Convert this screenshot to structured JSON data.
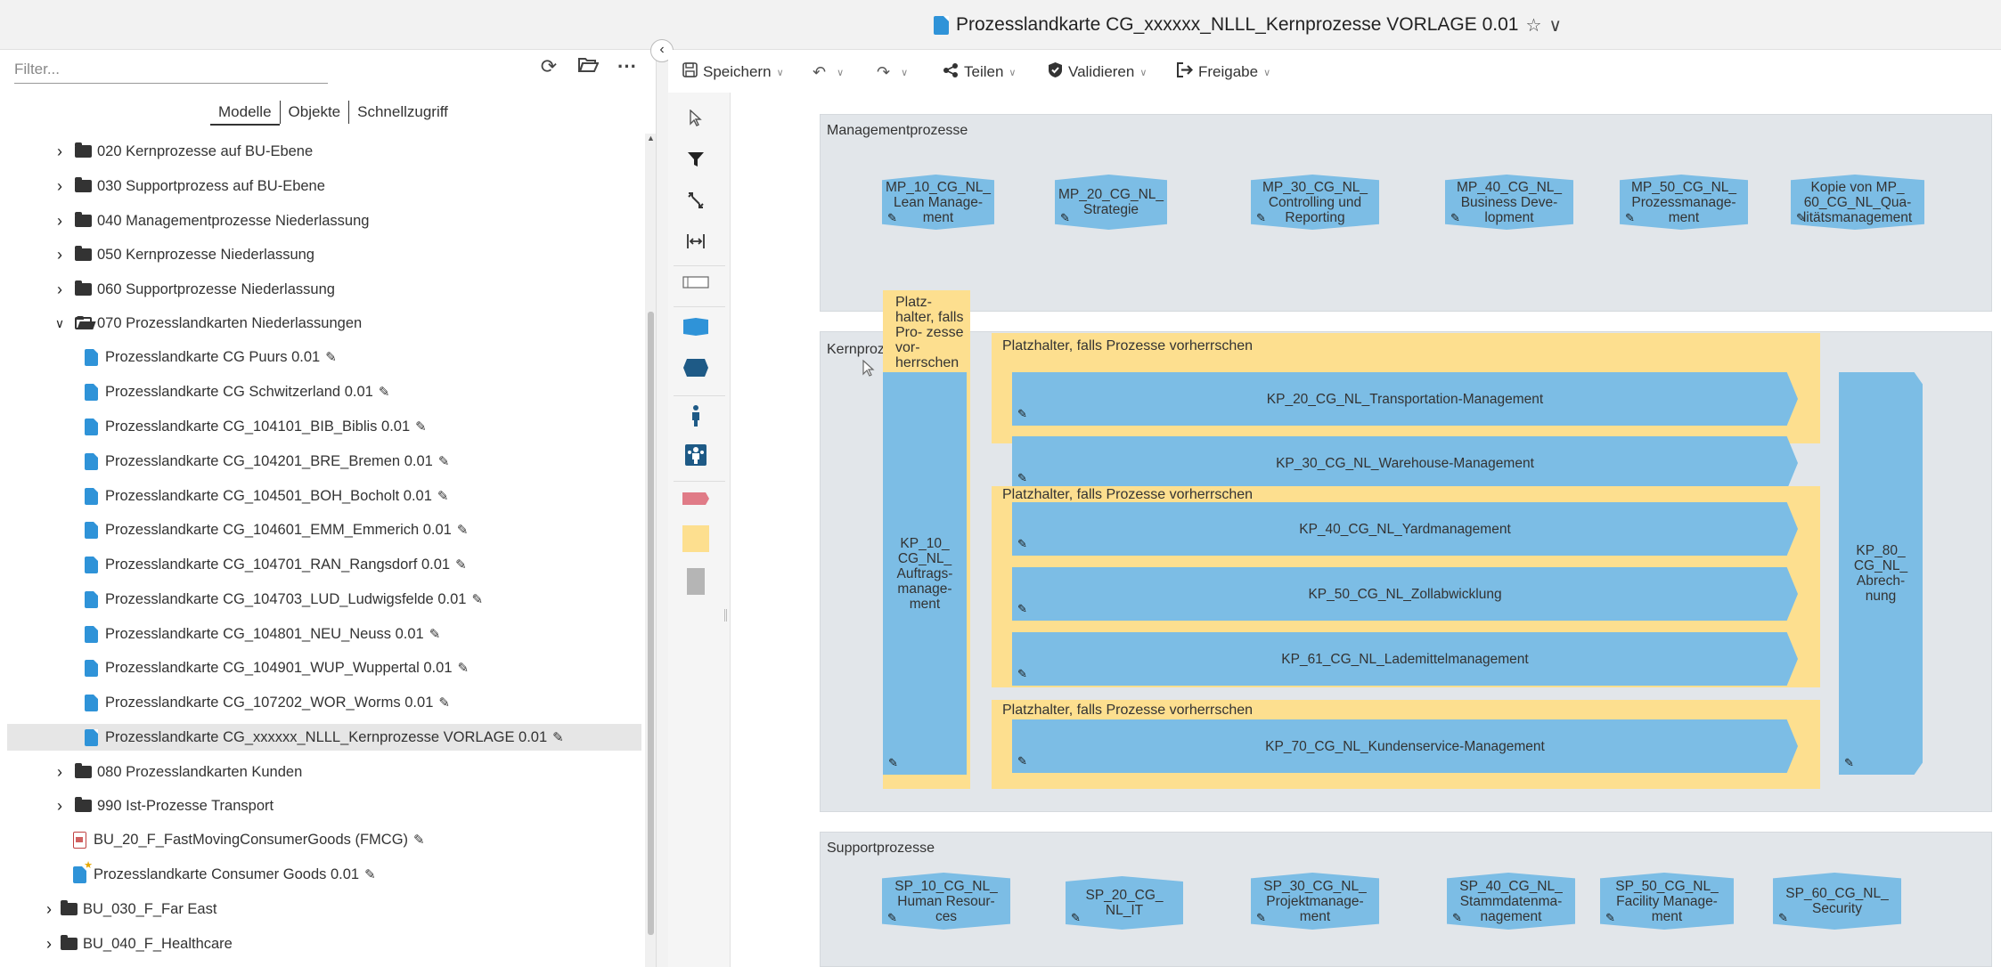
{
  "title": "Prozesslandkarte CG_xxxxxx_NLLL_Kernprozesse VORLAGE 0.01",
  "left_panel": {
    "filter_placeholder": "Filter...",
    "tabs": [
      "Modelle",
      "Objekte",
      "Schnellzugriff"
    ],
    "tree": [
      {
        "label": "020 Kernprozesse auf BU-Ebene"
      },
      {
        "label": "030 Supportprozess auf BU-Ebene"
      },
      {
        "label": "040 Managementprozesse Niederlassung"
      },
      {
        "label": "050 Kernprozesse Niederlassung"
      },
      {
        "label": "060 Supportprozesse Niederlassung"
      },
      {
        "label": "070 Prozesslandkarten Niederlassungen"
      },
      {
        "label": "Prozesslandkarte CG Puurs 0.01"
      },
      {
        "label": "Prozesslandkarte CG Schwitzerland 0.01"
      },
      {
        "label": "Prozesslandkarte CG_104101_BIB_Biblis 0.01"
      },
      {
        "label": "Prozesslandkarte CG_104201_BRE_Bremen 0.01"
      },
      {
        "label": "Prozesslandkarte CG_104501_BOH_Bocholt 0.01"
      },
      {
        "label": "Prozesslandkarte CG_104601_EMM_Emmerich 0.01"
      },
      {
        "label": "Prozesslandkarte CG_104701_RAN_Rangsdorf 0.01"
      },
      {
        "label": "Prozesslandkarte CG_104703_LUD_Ludwigsfelde 0.01"
      },
      {
        "label": "Prozesslandkarte CG_104801_NEU_Neuss 0.01"
      },
      {
        "label": "Prozesslandkarte CG_104901_WUP_Wuppertal 0.01"
      },
      {
        "label": "Prozesslandkarte CG_107202_WOR_Worms 0.01"
      },
      {
        "label": "Prozesslandkarte CG_xxxxxx_NLLL_Kernprozesse VORLAGE 0.01"
      },
      {
        "label": "080 Prozesslandkarten Kunden"
      },
      {
        "label": "990 Ist-Prozesse Transport"
      },
      {
        "label": "BU_20_F_FastMovingConsumerGoods (FMCG)"
      },
      {
        "label": "Prozesslandkarte Consumer Goods 0.01"
      },
      {
        "label": "BU_030_F_Far East"
      },
      {
        "label": "BU_040_F_Healthcare"
      }
    ]
  },
  "toolbar": {
    "save": "Speichern",
    "share": "Teilen",
    "validate": "Validieren",
    "release": "Freigabe"
  },
  "canvas": {
    "lanes": {
      "management": "Managementprozesse",
      "kern": "Kernprozesse",
      "support": "Supportprozesse"
    },
    "management_processes": [
      "MP_10_CG_NL_ Lean Manage- ment",
      "MP_20_CG_NL_ Strategie",
      "MP_30_CG_NL_ Controlling und Reporting",
      "MP_40_CG_NL_ Business Deve- lopment",
      "MP_50_CG_NL_ Prozessmanage- ment",
      "Kopie von MP_ 60_CG_NL_Qua- litätsmanagement"
    ],
    "notes": {
      "vertical": "Platz- halter, falls Pro- zesse vor- herrschen",
      "n1": "Platzhalter, falls Prozesse vorherrschen",
      "n2": "Platzhalter, falls Prozesse vorherrschen",
      "n3": "Platzhalter, falls Prozesse vorherrschen"
    },
    "kp10": "KP_10_ CG_NL_ Auftrags- manage- ment",
    "kp80": "KP_80_ CG_NL_ Abrech- nung",
    "kern_processes": [
      "KP_20_CG_NL_Transportation-Management",
      "KP_30_CG_NL_Warehouse-Management",
      "KP_40_CG_NL_Yardmanagement",
      "KP_50_CG_NL_Zollabwicklung",
      "KP_61_CG_NL_Lademittelmanagement",
      "KP_70_CG_NL_Kundenservice-Management"
    ],
    "support_processes": [
      "SP_10_CG_NL_ Human Resour- ces",
      "SP_20_CG_ NL_IT",
      "SP_30_CG_NL_ Projektmanage- ment",
      "SP_40_CG_NL_ Stammdatenma- nagement",
      "SP_50_CG_NL_ Facility Manage- ment",
      "SP_60_CG_NL_ Security"
    ]
  },
  "colors": {
    "process_blue": "#7cbde5",
    "note_yellow": "#fddf8f",
    "lane_gray": "#e2e6ea",
    "palette_red": "#e07b87"
  }
}
